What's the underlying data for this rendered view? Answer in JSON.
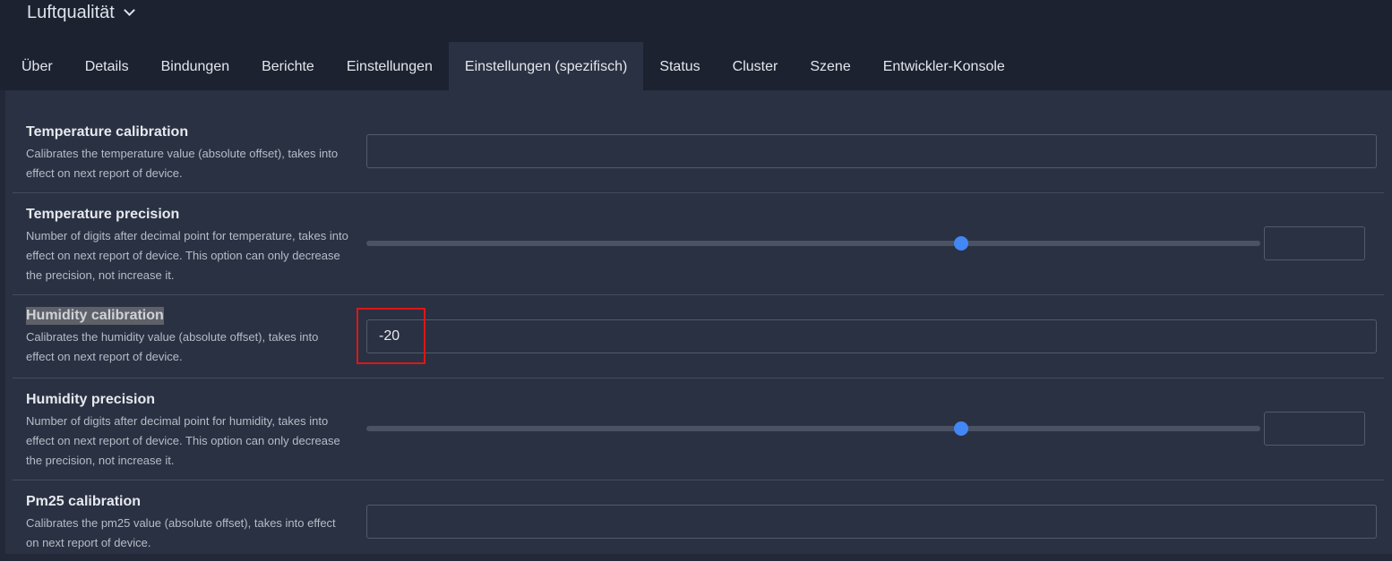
{
  "header": {
    "title": "Luftqualität"
  },
  "tabs": [
    {
      "label": "Über"
    },
    {
      "label": "Details"
    },
    {
      "label": "Bindungen"
    },
    {
      "label": "Berichte"
    },
    {
      "label": "Einstellungen"
    },
    {
      "label": "Einstellungen (spezifisch)"
    },
    {
      "label": "Status"
    },
    {
      "label": "Cluster"
    },
    {
      "label": "Szene"
    },
    {
      "label": "Entwickler-Konsole"
    }
  ],
  "active_tab": "Einstellungen (spezifisch)",
  "settings": [
    {
      "title": "Temperature calibration",
      "description": "Calibrates the temperature value (absolute offset), takes into effect on next report of device.",
      "control": "text",
      "value": ""
    },
    {
      "title": "Temperature precision",
      "description": "Number of digits after decimal point for temperature, takes into effect on next report of device. This option can only decrease the precision, not increase it.",
      "control": "slider",
      "slider_fraction": 0.665,
      "value": ""
    },
    {
      "title": "Humidity calibration",
      "description": "Calibrates the humidity value (absolute offset), takes into effect on next report of device.",
      "control": "text",
      "value": "-20"
    },
    {
      "title": "Humidity precision",
      "description": "Number of digits after decimal point for humidity, takes into effect on next report of device. This option can only decrease the precision, not increase it.",
      "control": "slider",
      "slider_fraction": 0.665,
      "value": ""
    },
    {
      "title": "Pm25 calibration",
      "description": "Calibrates the pm25 value (absolute offset), takes into effect on next report of device.",
      "control": "text",
      "value": ""
    }
  ],
  "colors": {
    "accent": "#4287f5",
    "annotation": "#e01515",
    "background": "#2a3142",
    "header_background": "#1c2230"
  }
}
